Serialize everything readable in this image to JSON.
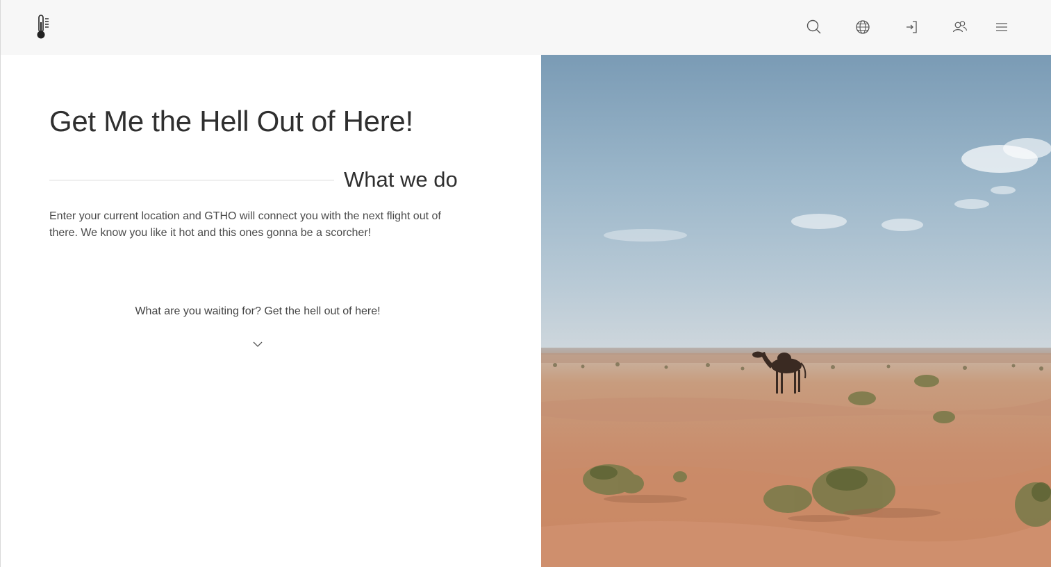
{
  "header": {
    "logo_icon": "thermometer-icon",
    "nav_icons": [
      "search-icon",
      "globe-icon",
      "sign-in-icon",
      "users-icon",
      "menu-icon"
    ]
  },
  "main": {
    "title": "Get Me the Hell Out of Here!",
    "section_heading": "What we do",
    "intro": "Enter your current location and GTHO will connect you with the next flight out of there. We know you like it hot and this ones gonna be a scorcher!",
    "cta": "What are you waiting for? Get the hell out of here!",
    "scroll_icon": "chevron-down-icon"
  },
  "hero": {
    "image": "desert-camel-photo",
    "colors": {
      "sky": "#8fb0c7",
      "sand": "#c98d6c"
    }
  }
}
